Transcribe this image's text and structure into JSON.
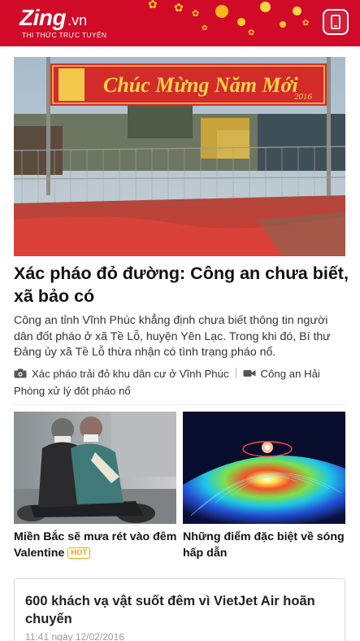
{
  "header": {
    "logo_text": "Zing",
    "logo_tld": ".vn",
    "tagline": "THI THỨC TRỰC TUYẾN",
    "background": "#d10a28",
    "menu_icon": "mobile-phone-icon"
  },
  "hero": {
    "image_icon": "photo",
    "banner_text": "Chúc Mừng Năm Mới",
    "banner_year": "2016",
    "title": "Xác pháo đỏ đường: Công an chưa biết, xã bảo có",
    "summary": "Công an tỉnh Vĩnh Phúc khẳng định chưa biết thông tin người dân đốt pháo ở xã Tề Lỗ, huyện Yên Lạc. Trong khi đó, Bí thư Đảng ủy xã Tề Lỗ thừa nhận có tình trạng pháo nổ.",
    "related": [
      {
        "icon": "camera-icon",
        "text": "Xác pháo trải đỏ khu dân cư ở Vĩnh Phúc"
      },
      {
        "icon": "video-camera-icon",
        "text": "Công an Hải Phòng xử lý đốt pháo nổ"
      }
    ]
  },
  "cards": [
    {
      "title": "Miền Bắc sẽ mưa rét vào đêm Valentine",
      "badge": "HOT"
    },
    {
      "title": "Những điểm đặc biệt về sóng hấp dẫn"
    }
  ],
  "news_card": {
    "title": "600 khách vạ vật suốt đêm vì VietJet Air hoãn chuyến",
    "time": "11:41 ngày 12/02/2016"
  },
  "colors": {
    "brand_red": "#d10a28",
    "hot_badge": "#f4a30f",
    "text": "#222222"
  }
}
